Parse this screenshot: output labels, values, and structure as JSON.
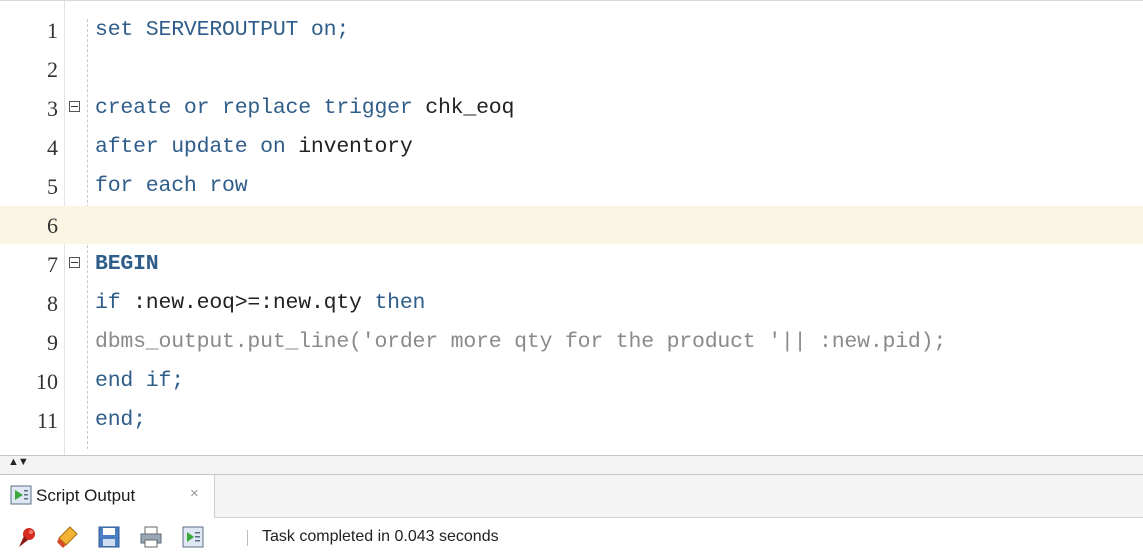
{
  "editor": {
    "lines": [
      {
        "num": "1",
        "tokens": [
          {
            "t": "set SERVEROUTPUT on;",
            "c": "kw"
          }
        ]
      },
      {
        "num": "2",
        "tokens": []
      },
      {
        "num": "3",
        "fold": true,
        "tokens": [
          {
            "t": "create or replace trigger ",
            "c": "kw"
          },
          {
            "t": "chk_eoq",
            "c": "id"
          }
        ]
      },
      {
        "num": "4",
        "tokens": [
          {
            "t": "after update on ",
            "c": "kw"
          },
          {
            "t": "inventory",
            "c": "id"
          }
        ]
      },
      {
        "num": "5",
        "tokens": [
          {
            "t": "for each row",
            "c": "kw"
          }
        ]
      },
      {
        "num": "6",
        "highlight": true,
        "tokens": []
      },
      {
        "num": "7",
        "fold": true,
        "tokens": [
          {
            "t": "BEGIN",
            "c": "kwb"
          }
        ]
      },
      {
        "num": "8",
        "tokens": [
          {
            "t": "if ",
            "c": "kw"
          },
          {
            "t": ":new.eoq>=:new.qty ",
            "c": "id"
          },
          {
            "t": "then",
            "c": "kw"
          }
        ]
      },
      {
        "num": "9",
        "tokens": [
          {
            "t": "dbms_output.put_line('order more qty for the product '|| :new.pid);",
            "c": "dim"
          }
        ]
      },
      {
        "num": "10",
        "tokens": [
          {
            "t": "end if;",
            "c": "kw"
          }
        ]
      },
      {
        "num": "11",
        "tokens": [
          {
            "t": "end;",
            "c": "kw"
          }
        ]
      }
    ]
  },
  "output_panel": {
    "tab_label": "Script Output",
    "close_glyph": "×",
    "status": "Task completed in 0.043 seconds",
    "toolbar_icons": [
      "pin-icon",
      "eraser-icon",
      "save-icon",
      "print-icon",
      "script-icon"
    ]
  },
  "colors": {
    "keyword": "#2f5d8a",
    "identifier": "#222222",
    "dimmed": "#8a8a8a",
    "current_line": "#fbf5e3"
  }
}
